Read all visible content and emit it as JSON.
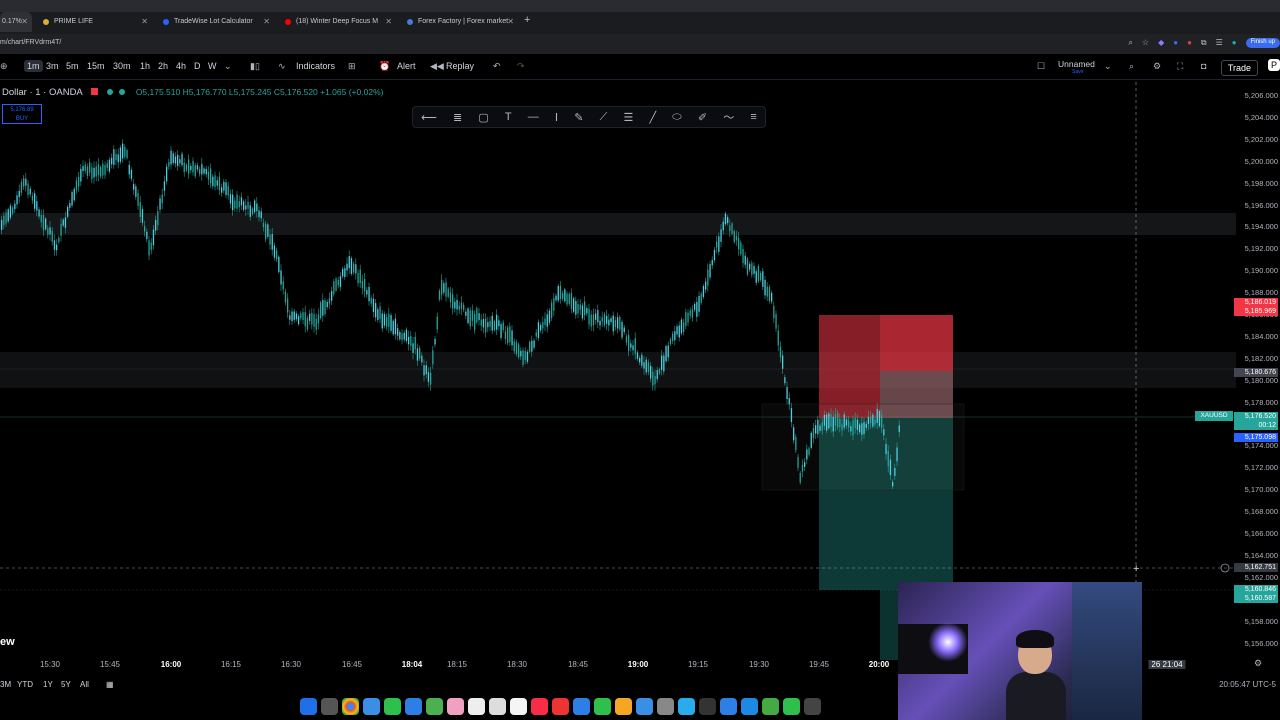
{
  "browser": {
    "tabs": [
      {
        "label": "0.17%",
        "close": "✕"
      },
      {
        "label": "PRIME LIFE",
        "close": "✕"
      },
      {
        "label": "TradeWise Lot Calculator",
        "close": "✕"
      },
      {
        "label": "(18) Winter Deep Focus M",
        "close": "✕"
      },
      {
        "label": "Forex Factory | Forex market",
        "close": "✕"
      }
    ],
    "new_tab": "+",
    "url": "m/chart/FRVdrm4T/",
    "finish_update": "Finish up"
  },
  "toolbar": {
    "intervals": [
      "1m",
      "3m",
      "5m",
      "15m",
      "30m",
      "1h",
      "2h",
      "4h",
      "D",
      "W"
    ],
    "selected_interval": "1m",
    "indicators": "Indicators",
    "alert": "Alert",
    "replay": "Replay",
    "layout_name": "Unnamed",
    "layout_sub": "Save",
    "trade": "Trade",
    "publish": "P"
  },
  "legend": {
    "symbol": "Dollar · 1 · OANDA",
    "ohlc": "O5,175.510  H5,176.770  L5,175.245  C5,176.520  +1.065 (+0.02%)"
  },
  "buy_box": {
    "price": "5,176.89",
    "label": "BUY"
  },
  "price_axis": {
    "labels": [
      "5,206.000",
      "5,204.000",
      "5,202.000",
      "5,200.000",
      "5,198.000",
      "5,196.000",
      "5,194.000",
      "5,192.000",
      "5,190.000",
      "5,188.000",
      "5,186.000",
      "5,184.000",
      "5,182.000",
      "5,180.000",
      "5,178.000",
      "5,176.000",
      "5,174.000",
      "5,172.000",
      "5,170.000",
      "5,168.000",
      "5,166.000",
      "5,164.000",
      "5,162.000",
      "5,160.000",
      "5,158.000",
      "5,156.000"
    ],
    "tags": {
      "stop_top": "5,186.019",
      "stop_bottom": "5,185.969",
      "level_mid": "5,180.676",
      "symbol": "XAUUSD",
      "current": "5,176.520",
      "countdown": "00:12",
      "entry": "5,175.098",
      "crosshair": "5,162.751",
      "target_top": "5,160.846",
      "target_bottom": "5,160.587"
    }
  },
  "time_axis": {
    "labels": [
      "15:30",
      "15:45",
      "16:00",
      "16:15",
      "16:30",
      "16:45",
      "18:04",
      "18:15",
      "18:30",
      "18:45",
      "19:00",
      "19:15",
      "19:30",
      "19:45",
      "20:00"
    ],
    "crosshair_time": "26  21:04",
    "edge_label": "ew"
  },
  "bottom": {
    "ranges": [
      "3M",
      "YTD",
      "1Y",
      "5Y",
      "All"
    ],
    "clock": "20:05:47 UTC-5"
  },
  "colors": {
    "bull": "#26a69a",
    "stop_zone": "#f23645",
    "target_zone": "#26a69a",
    "background": "#000000"
  }
}
